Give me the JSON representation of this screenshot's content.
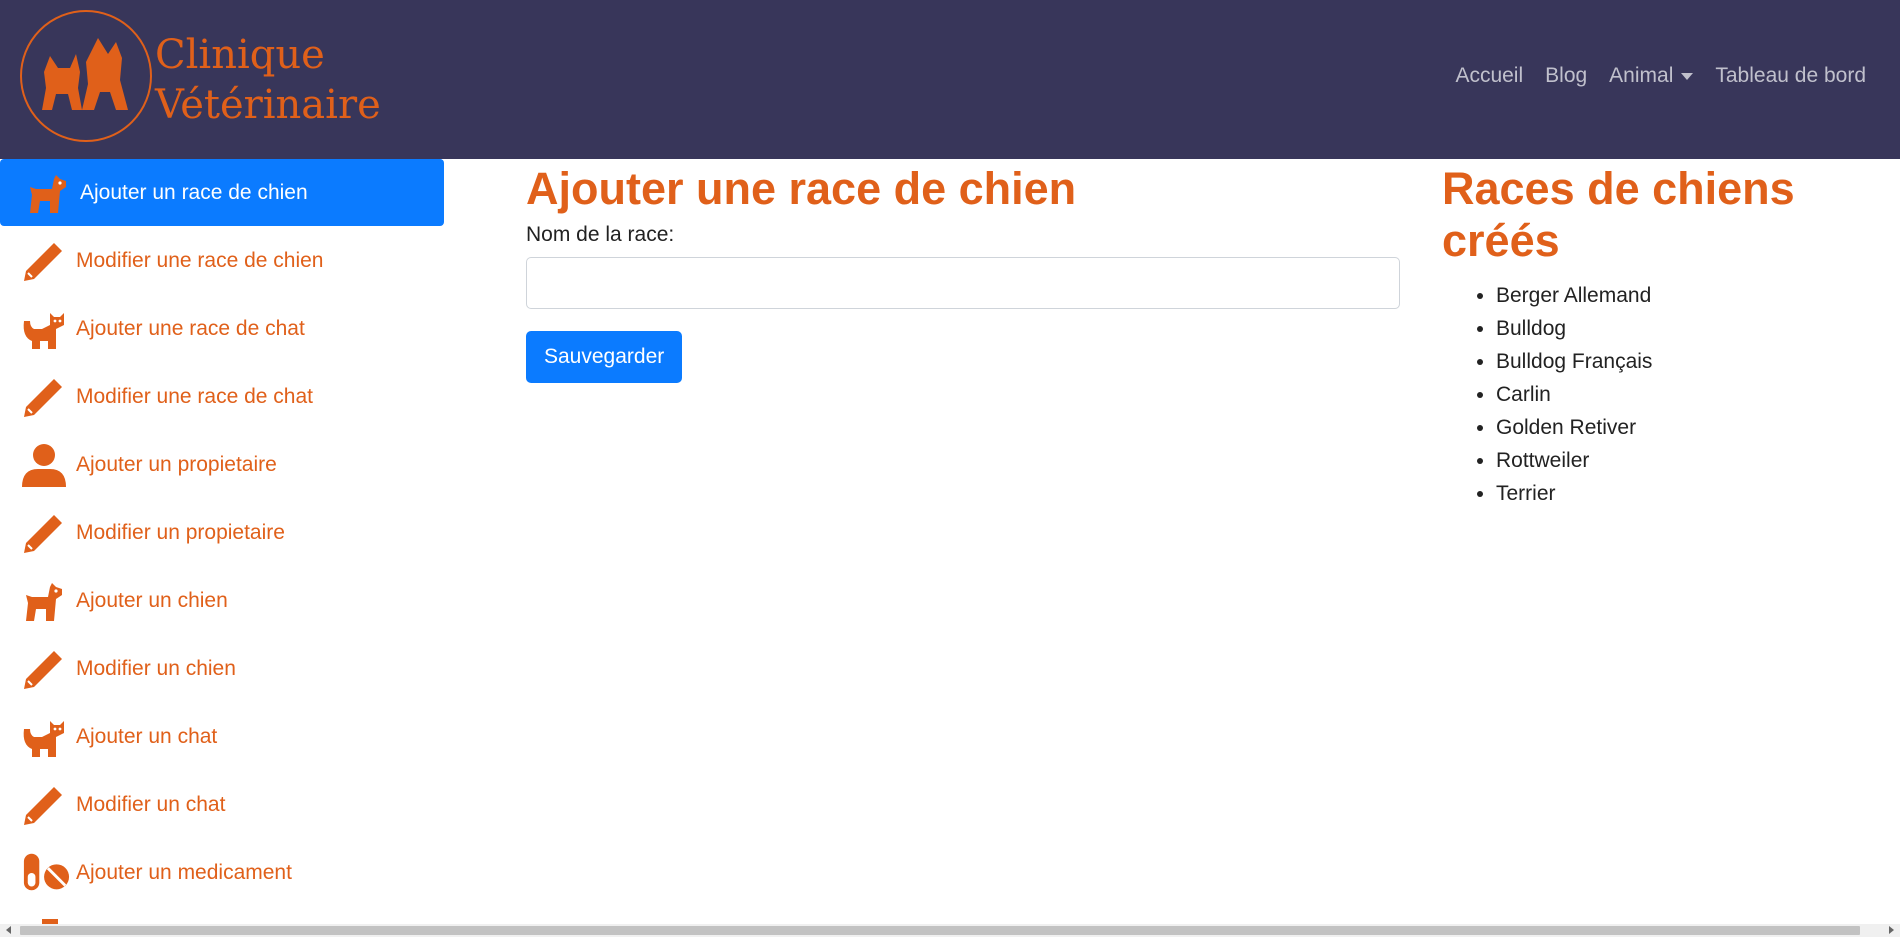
{
  "header": {
    "logo_line1": "Clinique",
    "logo_line2": "Vétérinaire",
    "nav": [
      {
        "label": "Accueil"
      },
      {
        "label": "Blog"
      },
      {
        "label": "Animal"
      },
      {
        "label": "Tableau de bord"
      }
    ]
  },
  "sidebar": {
    "items": [
      {
        "label": "Ajouter un race de chien",
        "icon": "dog-icon",
        "active": true
      },
      {
        "label": "Modifier une race de chien",
        "icon": "pencil-icon"
      },
      {
        "label": "Ajouter une race de chat",
        "icon": "cat-icon"
      },
      {
        "label": "Modifier une race de chat",
        "icon": "pencil-icon"
      },
      {
        "label": "Ajouter un propietaire",
        "icon": "user-icon"
      },
      {
        "label": "Modifier un propietaire",
        "icon": "pencil-icon"
      },
      {
        "label": "Ajouter un chien",
        "icon": "dog-icon"
      },
      {
        "label": "Modifier un chien",
        "icon": "pencil-icon"
      },
      {
        "label": "Ajouter un chat",
        "icon": "cat-icon"
      },
      {
        "label": "Modifier un chat",
        "icon": "pencil-icon"
      },
      {
        "label": "Ajouter un medicament",
        "icon": "pills-icon"
      }
    ]
  },
  "main": {
    "title": "Ajouter une race de chien",
    "field_label": "Nom de la race:",
    "field_value": "",
    "save_label": "Sauvegarder"
  },
  "list_panel": {
    "title": "Races de chiens créés",
    "breeds": [
      "Berger Allemand",
      "Bulldog",
      "Bulldog Français",
      "Carlin",
      "Golden Retiver",
      "Rottweiler",
      "Terrier"
    ]
  },
  "colors": {
    "navbar_bg": "#38365a",
    "accent": "#e0601a",
    "primary": "#0b7bff"
  }
}
